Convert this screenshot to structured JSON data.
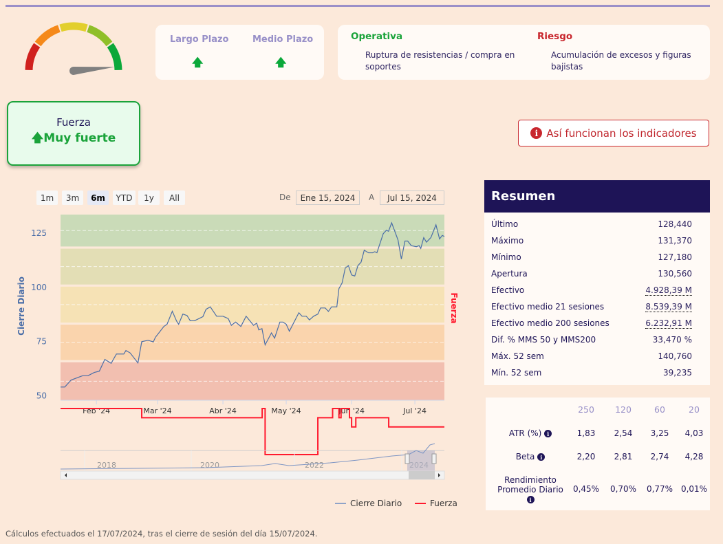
{
  "gauge": {
    "segments_colors": [
      "#d0211e",
      "#f5891a",
      "#e2cf2d",
      "#8fbf29",
      "#0ba83a"
    ],
    "needle_fraction": 0.97
  },
  "plazos": [
    {
      "label": "Largo Plazo",
      "icon": "arrow-up-icon",
      "arrow": "🡅"
    },
    {
      "label": "Medio Plazo",
      "icon": "arrow-up-icon",
      "arrow": "🡅"
    }
  ],
  "operativa": {
    "title": "Operativa",
    "text": "Ruptura de resistencias / compra en soportes",
    "color": "#1aa33a"
  },
  "riesgo": {
    "title": "Riesgo",
    "text": "Acumulación de excesos y figuras bajistas",
    "color": "#c8262d"
  },
  "fuerza": {
    "label": "Fuerza",
    "value": "Muy fuerte",
    "arrow": "🡅"
  },
  "info_button": {
    "icon": "i",
    "label": "Así funcionan los indicadores"
  },
  "range_buttons": [
    "1m",
    "3m",
    "6m",
    "YTD",
    "1y",
    "All"
  ],
  "range_selected": "6m",
  "date_from_label": "De",
  "date_from": "Ene 15, 2024",
  "date_to_label": "A",
  "date_to": "Jul 15, 2024",
  "chart_data": {
    "type": "line",
    "ylabel": "Cierre Diario",
    "y2label": "Fuerza",
    "ylim": [
      48,
      133.5
    ],
    "yticks": [
      50,
      75,
      100,
      125
    ],
    "x_start": "2024-01-15",
    "x_days": 182,
    "xticks": [
      {
        "label": "Feb '24",
        "day": 17
      },
      {
        "label": "Mar '24",
        "day": 46
      },
      {
        "label": "Abr '24",
        "day": 77
      },
      {
        "label": "May '24",
        "day": 107
      },
      {
        "label": "Jun '24",
        "day": 138
      },
      {
        "label": "Jul '24",
        "day": 168
      }
    ],
    "bands": [
      {
        "from": 48,
        "to": 65.5,
        "color": "#f2bfb0"
      },
      {
        "from": 66.5,
        "to": 82.8,
        "color": "#fad4ad"
      },
      {
        "from": 83.8,
        "to": 100.3,
        "color": "#f6e2b5"
      },
      {
        "from": 101.3,
        "to": 117.8,
        "color": "#e3deb5"
      },
      {
        "from": 118.8,
        "to": 133.5,
        "color": "#cadbb8"
      }
    ],
    "series": [
      {
        "name": "Cierre Diario",
        "color": "#4a6ea8",
        "points": [
          [
            0,
            54.1
          ],
          [
            2,
            54.1
          ],
          [
            5,
            57.3
          ],
          [
            8.5,
            58.6
          ],
          [
            10.5,
            59.3
          ],
          [
            13,
            59.3
          ],
          [
            16,
            60.8
          ],
          [
            18.4,
            61.4
          ],
          [
            21,
            66.8
          ],
          [
            24,
            65
          ],
          [
            26.5,
            69.3
          ],
          [
            30,
            69.3
          ],
          [
            31,
            70.9
          ],
          [
            33,
            69.8
          ],
          [
            36.7,
            65.2
          ],
          [
            38.5,
            75
          ],
          [
            41.5,
            75.6
          ],
          [
            44,
            74.9
          ],
          [
            45,
            77
          ],
          [
            49,
            82
          ],
          [
            50.5,
            83
          ],
          [
            53,
            89
          ],
          [
            55,
            84.5
          ],
          [
            56,
            83
          ],
          [
            58,
            87.7
          ],
          [
            60,
            87
          ],
          [
            61.5,
            84.6
          ],
          [
            63.5,
            84.6
          ],
          [
            67.5,
            86.5
          ],
          [
            69,
            89.9
          ],
          [
            71,
            91
          ],
          [
            74,
            86.7
          ],
          [
            77,
            86.7
          ],
          [
            79.5,
            85.6
          ],
          [
            81,
            82.5
          ],
          [
            83,
            84
          ],
          [
            85.5,
            82
          ],
          [
            88,
            86.7
          ],
          [
            91.5,
            82.5
          ],
          [
            93,
            83.5
          ],
          [
            94,
            80.4
          ],
          [
            95.5,
            81
          ],
          [
            97,
            73.5
          ],
          [
            100,
            79
          ],
          [
            101.5,
            76.6
          ],
          [
            104,
            84
          ],
          [
            105.5,
            84
          ],
          [
            107,
            83
          ],
          [
            108.5,
            79.8
          ],
          [
            113,
            88.3
          ],
          [
            114.5,
            86.7
          ],
          [
            116.5,
            86.7
          ],
          [
            118,
            85
          ],
          [
            120,
            86.7
          ],
          [
            122,
            87.7
          ],
          [
            123.3,
            90.5
          ],
          [
            125.5,
            90.5
          ],
          [
            127,
            88.9
          ],
          [
            128.5,
            91
          ],
          [
            131,
            91
          ],
          [
            132,
            99.4
          ],
          [
            133.5,
            102
          ],
          [
            135,
            108.9
          ],
          [
            136.5,
            110
          ],
          [
            138,
            105.7
          ],
          [
            139.5,
            105.2
          ],
          [
            141,
            110
          ],
          [
            142.5,
            111.6
          ],
          [
            144,
            117.1
          ],
          [
            146,
            115.9
          ],
          [
            148,
            115.9
          ],
          [
            149,
            116.4
          ],
          [
            150,
            115.9
          ],
          [
            153,
            124.7
          ],
          [
            154.5,
            126.3
          ],
          [
            155.5,
            125.8
          ],
          [
            157,
            129.7
          ],
          [
            160,
            121.8
          ],
          [
            161.6,
            113
          ],
          [
            163.3,
            121.3
          ],
          [
            164.6,
            121.3
          ],
          [
            166.3,
            119.2
          ],
          [
            168.7,
            118.7
          ],
          [
            170,
            119.2
          ],
          [
            170.8,
            117.9
          ],
          [
            172.2,
            122.9
          ],
          [
            173.5,
            120.8
          ],
          [
            175.6,
            122.9
          ],
          [
            178,
            128.8
          ],
          [
            179.7,
            122.3
          ],
          [
            181,
            123.9
          ],
          [
            182,
            123.4
          ]
        ]
      },
      {
        "name": "Fuerza",
        "color": "#ff1a2e",
        "ylim": [
          0,
          100
        ],
        "step": true,
        "points": [
          [
            0,
            100
          ],
          [
            38.5,
            95
          ],
          [
            95.6,
            100
          ],
          [
            97,
            75
          ],
          [
            122,
            95
          ],
          [
            129,
            100
          ],
          [
            132,
            95
          ],
          [
            133,
            100
          ],
          [
            137,
            95
          ],
          [
            138,
            90
          ],
          [
            140,
            95
          ],
          [
            155.6,
            90
          ],
          [
            182,
            90
          ]
        ]
      }
    ]
  },
  "navigator": {
    "years": [
      "2018",
      "2020",
      "2022",
      "2024"
    ]
  },
  "legend": [
    "Cierre Diario",
    "Fuerza"
  ],
  "resumen": {
    "title": "Resumen",
    "rows": [
      {
        "label": "Último",
        "value": "128,440"
      },
      {
        "label": "Máximo",
        "value": "131,370"
      },
      {
        "label": "Mínimo",
        "value": "127,180"
      },
      {
        "label": "Apertura",
        "value": "130,560"
      },
      {
        "label": "Efectivo",
        "value": "4.928,39 M"
      },
      {
        "label": "Efectivo medio 21 sesiones",
        "value": "8.539,39 M"
      },
      {
        "label": "Efectivo medio 200 sesiones",
        "value": "6.232,91 M"
      },
      {
        "label": "Dif. % MMS 50 y MMS200",
        "value": "33,470 %"
      },
      {
        "label": "Máx. 52 sem",
        "value": "140,760"
      },
      {
        "label": "Mín. 52 sem",
        "value": "39,235"
      }
    ]
  },
  "stats": {
    "headers": [
      "250",
      "120",
      "60",
      "20"
    ],
    "rows": [
      {
        "label": "ATR (%)",
        "values": [
          "1,83",
          "2,54",
          "3,25",
          "4,03"
        ]
      },
      {
        "label": "Beta",
        "values": [
          "2,20",
          "2,81",
          "2,74",
          "4,28"
        ]
      },
      {
        "label": "Rendimiento Promedio Diario",
        "values": [
          "0,45%",
          "0,70%",
          "0,77%",
          "0,01%"
        ]
      }
    ],
    "info_icon": "i"
  },
  "footer": "Cálculos efectuados el 17/07/2024, tras el cierre de sesión del día 15/07/2024."
}
